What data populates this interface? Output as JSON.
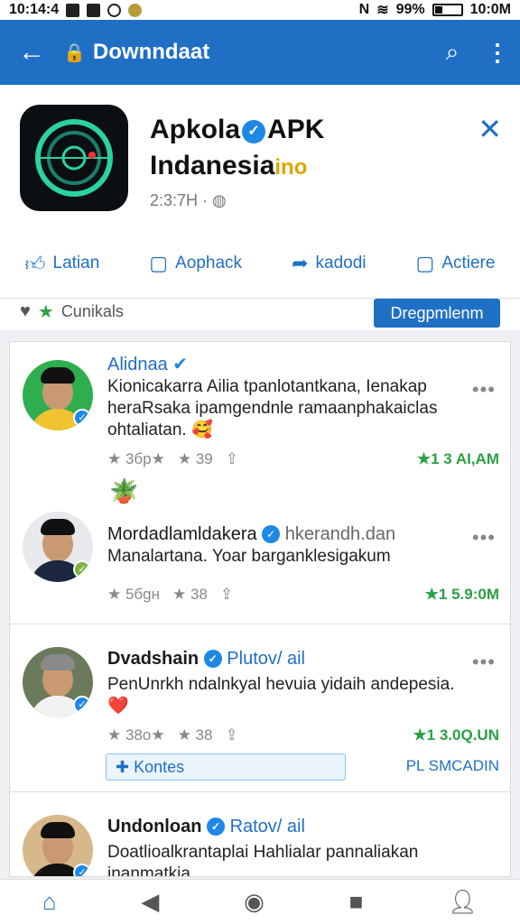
{
  "status_bar": {
    "time": "10:14:4",
    "network": "N",
    "battery_percent": "99%",
    "clock_right": "10:0M"
  },
  "app_bar": {
    "title": "Downndaat"
  },
  "app_header": {
    "name_line1": "Apkola",
    "name_suffix": "APK",
    "name_line2": "Indanesia",
    "name_tag": "ino",
    "meta": "2:3:7H ·"
  },
  "actions": [
    {
      "label": "Latian",
      "icon": "thumbs-up-icon"
    },
    {
      "label": "Aophack",
      "icon": "comment-icon"
    },
    {
      "label": "kadodi",
      "icon": "share-icon"
    },
    {
      "label": "Actiere",
      "icon": "message-icon"
    }
  ],
  "filter": {
    "label": "Cunikals",
    "button": "Dregpmlenm"
  },
  "posts": [
    {
      "name": "Alidnaa",
      "text": "Kionicakarra Ailia tpanlotantkana, Ienakap heraRsaka ipamgendnle ramaanphakaiclas ohtaliatan.",
      "emoji": "🥰",
      "stat1": "★ 3бр★",
      "stat2": "★ 39",
      "time": "★1 3 AI,AM",
      "colors": {
        "bg": "#2fae4f"
      }
    },
    {
      "name": "Mordadlamldakera",
      "handle": "hkerandh.dan",
      "text": "Manalartana. Yoar barganklesigakum",
      "stat1": "★ 5бgн",
      "stat2": "★ 38",
      "time": "★1 5.9:0M",
      "colors": {
        "bg": "#e7e9ec"
      }
    },
    {
      "name": "Dvadshain",
      "handle": "Plutov/ ail",
      "text": "PenUnrkh ndalnkyal hevuia yidaih andepesia.",
      "emoji": "❤️",
      "stat1": "★ 38о★",
      "stat2": "★ 38",
      "time": "★1 3.0Q.UN",
      "reply": "Kontes",
      "reply_right": "PL SMCADIN",
      "colors": {
        "bg": "#6a7a5a"
      }
    },
    {
      "name": "Undonloan",
      "handle": "Ratov/ ail",
      "text": "Doatlioalkrantaplai Hahlialar pannaliakan inanmatkia.",
      "colors": {
        "bg": "#d7b88a"
      }
    }
  ],
  "colors": {
    "primary": "#1f6fc5",
    "accent_green": "#2aa043",
    "verified_blue": "#1e88e5"
  }
}
